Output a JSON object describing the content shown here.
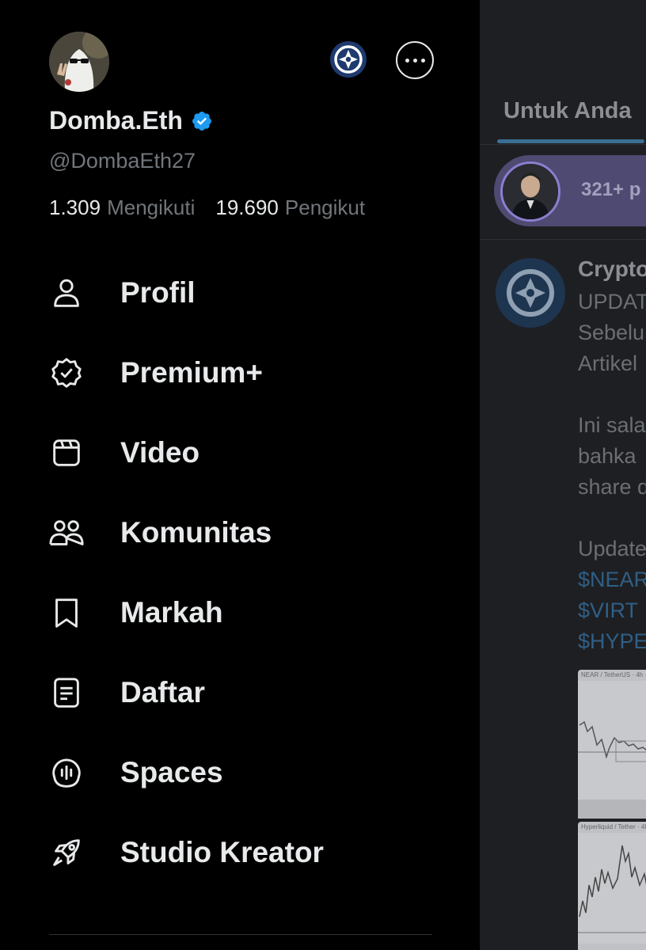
{
  "drawer": {
    "display_name": "Domba.Eth",
    "handle": "@DombaEth27",
    "following_count": "1.309",
    "following_label": "Mengikuti",
    "followers_count": "19.690",
    "followers_label": "Pengikut",
    "items": [
      {
        "label": "Profil",
        "icon": "person-icon"
      },
      {
        "label": "Premium+",
        "icon": "verified-badge-icon"
      },
      {
        "label": "Video",
        "icon": "video-icon"
      },
      {
        "label": "Komunitas",
        "icon": "communities-icon"
      },
      {
        "label": "Markah",
        "icon": "bookmark-icon"
      },
      {
        "label": "Daftar",
        "icon": "list-icon"
      },
      {
        "label": "Spaces",
        "icon": "spaces-icon"
      },
      {
        "label": "Studio Kreator",
        "icon": "rocket-icon"
      }
    ]
  },
  "timeline": {
    "tab_label": "Untuk Anda",
    "spaces_text": "321+ p",
    "post": {
      "author": "Crypto",
      "lines": [
        "UPDAT",
        "Sebelu",
        "Artikel",
        "",
        "Ini sala",
        "bahka",
        "share d",
        "",
        "Update"
      ],
      "tickers": [
        "$NEAR",
        "$VIRT",
        "$HYPE"
      ]
    },
    "chart_labels": [
      "NEAR / TetherUS · 4h · Bina",
      "Hyperliquid / Tether · 4h ·"
    ]
  },
  "colors": {
    "background": "#000000",
    "text_primary": "#e7e9ea",
    "text_secondary": "#71767b",
    "verified_blue": "#1d9bf0",
    "spaces_purple": "#4f4a72"
  }
}
